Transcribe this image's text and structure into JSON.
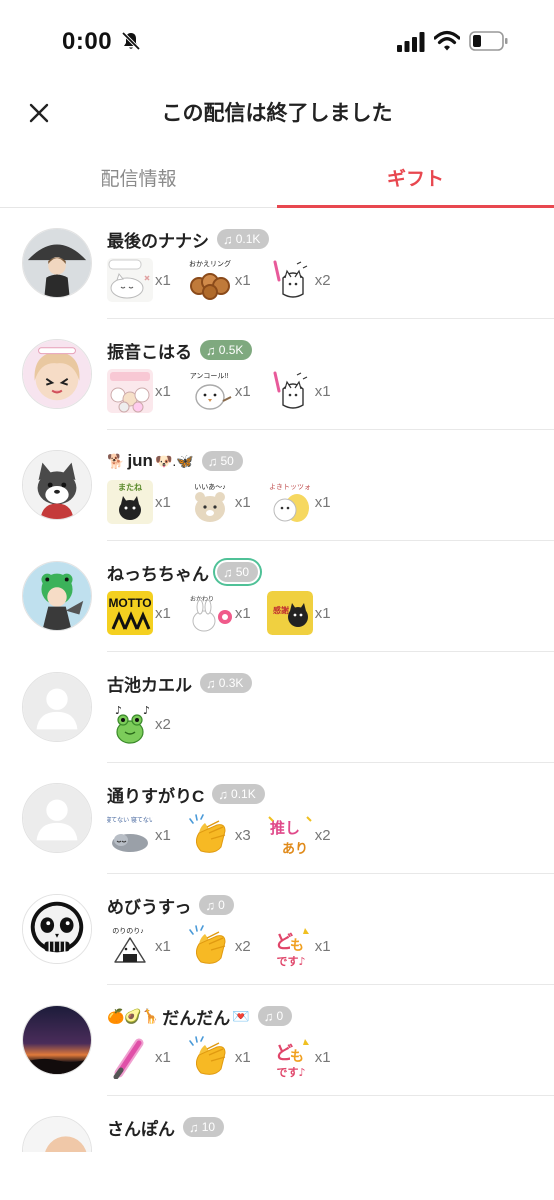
{
  "status": {
    "time": "0:00"
  },
  "header": {
    "title": "この配信は終了しました"
  },
  "tabs": [
    {
      "label": "配信情報",
      "active": false
    },
    {
      "label": "ギフト",
      "active": true
    }
  ],
  "colors": {
    "accent": "#e8474f",
    "badge_gray": "#c8c8c8",
    "badge_green": "#7fa97f",
    "badge_outline": "#4fc197"
  },
  "viewers": [
    {
      "name": "最後のナナシ",
      "prefix": "",
      "suffix": "",
      "badge": "0.1K",
      "badge_style": "gray",
      "gifts": [
        {
          "icon": "sticker-cat-sleepy",
          "count": "x1"
        },
        {
          "icon": "sticker-donut-ring",
          "count": "x1"
        },
        {
          "icon": "sticker-cat-penlight",
          "count": "x2"
        }
      ]
    },
    {
      "name": "振音こはる",
      "prefix": "",
      "suffix": "",
      "badge": "0.5K",
      "badge_style": "green",
      "gifts": [
        {
          "icon": "sticker-cats-cheer",
          "count": "x1"
        },
        {
          "icon": "sticker-bird-encore",
          "count": "x1"
        },
        {
          "icon": "sticker-cat-penlight",
          "count": "x1"
        }
      ]
    },
    {
      "name": "jun",
      "prefix": "🐕",
      "suffix": "🐶.🦋",
      "badge": "50",
      "badge_style": "gray",
      "gifts": [
        {
          "icon": "sticker-cat-bye",
          "count": "x1"
        },
        {
          "icon": "sticker-bear-nice",
          "count": "x1"
        },
        {
          "icon": "sticker-cat-cheer",
          "count": "x1"
        }
      ]
    },
    {
      "name": "ねっちちゃん",
      "prefix": "",
      "suffix": "",
      "badge": "50",
      "badge_style": "outlined",
      "gifts": [
        {
          "icon": "sticker-motto-text",
          "count": "x1"
        },
        {
          "icon": "sticker-bunny-more",
          "count": "x1"
        },
        {
          "icon": "sticker-cat-thanks",
          "count": "x1"
        }
      ]
    },
    {
      "name": "古池カエル",
      "prefix": "",
      "suffix": "",
      "badge": "0.3K",
      "badge_style": "gray",
      "gifts": [
        {
          "icon": "sticker-frog-music",
          "count": "x2"
        }
      ]
    },
    {
      "name": "通りすがりC",
      "prefix": "",
      "suffix": "",
      "badge": "0.1K",
      "badge_style": "gray",
      "gifts": [
        {
          "icon": "sticker-cat-sleeping",
          "count": "x1"
        },
        {
          "icon": "clapping-hands-icon",
          "count": "x3"
        },
        {
          "icon": "sticker-oshi-text",
          "count": "x2"
        }
      ]
    },
    {
      "name": "めびうすっ",
      "prefix": "",
      "suffix": "",
      "badge": "0",
      "badge_style": "gray",
      "gifts": [
        {
          "icon": "sticker-onigiri",
          "count": "x1"
        },
        {
          "icon": "clapping-hands-icon",
          "count": "x2"
        },
        {
          "icon": "sticker-domo-text",
          "count": "x1"
        }
      ]
    },
    {
      "name": "だんだん",
      "prefix": "🍊🥑🦒",
      "suffix": "💌",
      "badge": "0",
      "badge_style": "gray",
      "gifts": [
        {
          "icon": "sticker-pink-penlight",
          "count": "x1"
        },
        {
          "icon": "clapping-hands-icon",
          "count": "x1"
        },
        {
          "icon": "sticker-domo-text",
          "count": "x1"
        }
      ]
    },
    {
      "name": "さんぽん",
      "prefix": "",
      "suffix": "",
      "badge": "10",
      "badge_style": "gray",
      "gifts": []
    }
  ]
}
